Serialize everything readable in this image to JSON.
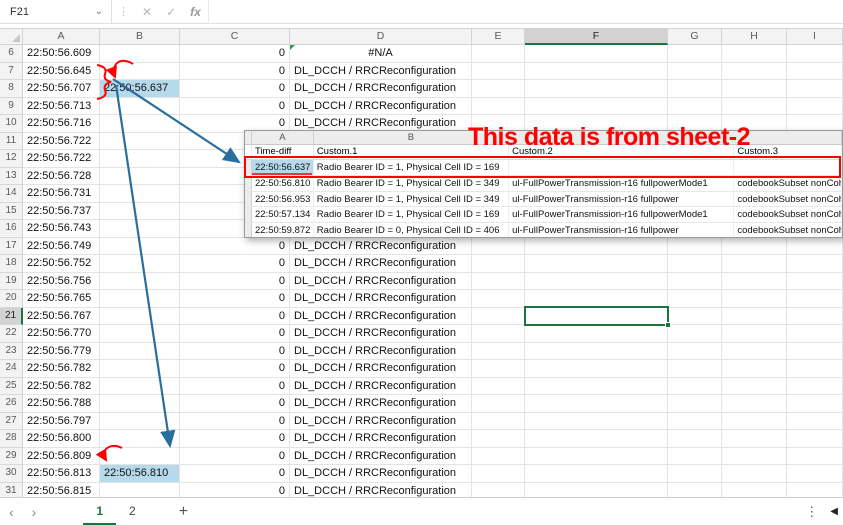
{
  "formula_bar": {
    "name_box": "F21",
    "formula_value": "",
    "icons": {
      "dropdown": "⌄",
      "handle": "⋮",
      "cancel": "✕",
      "enter": "✓",
      "fx": "fx"
    }
  },
  "grid": {
    "columns": [
      "A",
      "B",
      "C",
      "D",
      "E",
      "F",
      "G",
      "H",
      "I"
    ],
    "selected_cell": "F21",
    "selected_column": "F",
    "selected_row": "21",
    "rows": [
      {
        "num": "6",
        "a": "22:50:56.609",
        "b": "",
        "c": "0",
        "d": "#N/A",
        "d_center": true,
        "d_error": true
      },
      {
        "num": "7",
        "a": "22:50:56.645",
        "b": "",
        "c": "0",
        "d": "DL_DCCH / RRCReconfiguration"
      },
      {
        "num": "8",
        "a": "22:50:56.707",
        "b": "22:50:56.637",
        "b_highlight": true,
        "c": "0",
        "d": "DL_DCCH / RRCReconfiguration"
      },
      {
        "num": "9",
        "a": "22:50:56.713",
        "b": "",
        "c": "0",
        "d": "DL_DCCH / RRCReconfiguration"
      },
      {
        "num": "10",
        "a": "22:50:56.716",
        "b": "",
        "c": "0",
        "d": "DL_DCCH / RRCReconfiguration"
      },
      {
        "num": "11",
        "a": "22:50:56.722",
        "b": "",
        "c": "",
        "d": ""
      },
      {
        "num": "12",
        "a": "22:50:56.722",
        "b": "",
        "c": "",
        "d": ""
      },
      {
        "num": "13",
        "a": "22:50:56.728",
        "b": "",
        "c": "",
        "d": ""
      },
      {
        "num": "14",
        "a": "22:50:56.731",
        "b": "",
        "c": "",
        "d": ""
      },
      {
        "num": "15",
        "a": "22:50:56.737",
        "b": "",
        "c": "",
        "d": ""
      },
      {
        "num": "16",
        "a": "22:50:56.743",
        "b": "",
        "c": "",
        "d": ""
      },
      {
        "num": "17",
        "a": "22:50:56.749",
        "b": "",
        "c": "0",
        "d": "DL_DCCH / RRCReconfiguration"
      },
      {
        "num": "18",
        "a": "22:50:56.752",
        "b": "",
        "c": "0",
        "d": "DL_DCCH / RRCReconfiguration"
      },
      {
        "num": "19",
        "a": "22:50:56.756",
        "b": "",
        "c": "0",
        "d": "DL_DCCH / RRCReconfiguration"
      },
      {
        "num": "20",
        "a": "22:50:56.765",
        "b": "",
        "c": "0",
        "d": "DL_DCCH / RRCReconfiguration"
      },
      {
        "num": "21",
        "a": "22:50:56.767",
        "b": "",
        "c": "0",
        "d": "DL_DCCH / RRCReconfiguration"
      },
      {
        "num": "22",
        "a": "22:50:56.770",
        "b": "",
        "c": "0",
        "d": "DL_DCCH / RRCReconfiguration"
      },
      {
        "num": "23",
        "a": "22:50:56.779",
        "b": "",
        "c": "0",
        "d": "DL_DCCH / RRCReconfiguration"
      },
      {
        "num": "24",
        "a": "22:50:56.782",
        "b": "",
        "c": "0",
        "d": "DL_DCCH / RRCReconfiguration"
      },
      {
        "num": "25",
        "a": "22:50:56.782",
        "b": "",
        "c": "0",
        "d": "DL_DCCH / RRCReconfiguration"
      },
      {
        "num": "26",
        "a": "22:50:56.788",
        "b": "",
        "c": "0",
        "d": "DL_DCCH / RRCReconfiguration"
      },
      {
        "num": "27",
        "a": "22:50:56.797",
        "b": "",
        "c": "0",
        "d": "DL_DCCH / RRCReconfiguration"
      },
      {
        "num": "28",
        "a": "22:50:56.800",
        "b": "",
        "c": "0",
        "d": "DL_DCCH / RRCReconfiguration"
      },
      {
        "num": "29",
        "a": "22:50:56.809",
        "b": "",
        "c": "0",
        "d": "DL_DCCH / RRCReconfiguration"
      },
      {
        "num": "30",
        "a": "22:50:56.813",
        "b": "22:50:56.810",
        "b_highlight": true,
        "c": "0",
        "d": "DL_DCCH / RRCReconfiguration"
      },
      {
        "num": "31",
        "a": "22:50:56.815",
        "b": "",
        "c": "0",
        "d": "DL_DCCH / RRCReconfiguration"
      }
    ]
  },
  "sheet2_overlay": {
    "annotation_text": "This data is from sheet-2",
    "column_letters": [
      "A",
      "B"
    ],
    "header_row": [
      "Time-diff",
      "Custom.1",
      "Custom.2",
      "Custom.3"
    ],
    "rows": [
      {
        "time": "22:50:56.637",
        "highlight": true,
        "custom1": "Radio Bearer ID = 1, Physical Cell ID = 169",
        "custom2": "",
        "custom3": ""
      },
      {
        "time": "22:50:56.810",
        "custom1": "Radio Bearer ID = 1, Physical Cell ID = 349",
        "custom2": "ul-FullPowerTransmission-r16 fullpowerMode1",
        "custom3": "codebookSubset nonCoh"
      },
      {
        "time": "22:50:56.953",
        "custom1": "Radio Bearer ID = 1, Physical Cell ID = 349",
        "custom2": "ul-FullPowerTransmission-r16 fullpower",
        "custom3": "codebookSubset nonCoh"
      },
      {
        "time": "22:50:57.134",
        "custom1": "Radio Bearer ID = 1, Physical Cell ID = 169",
        "custom2": "ul-FullPowerTransmission-r16 fullpowerMode1",
        "custom3": "codebookSubset nonCoh"
      },
      {
        "time": "22:50:59.872",
        "custom1": "Radio Bearer ID = 0, Physical Cell ID = 406",
        "custom2": "ul-FullPowerTransmission-r16 fullpower",
        "custom3": "codebookSubset nonCoh"
      }
    ]
  },
  "tab_bar": {
    "nav_prev": "‹",
    "nav_next": "›",
    "tabs": [
      {
        "label": "1",
        "active": true
      },
      {
        "label": "2",
        "active": false
      }
    ],
    "add": "+",
    "more": "⋮",
    "scroll_left": "◀"
  },
  "colors": {
    "selection_green": "#1a7340",
    "highlight_blue": "#b6d9ec",
    "annotation_red": "#ff0000",
    "arrow_blue": "#2a6e9e"
  }
}
